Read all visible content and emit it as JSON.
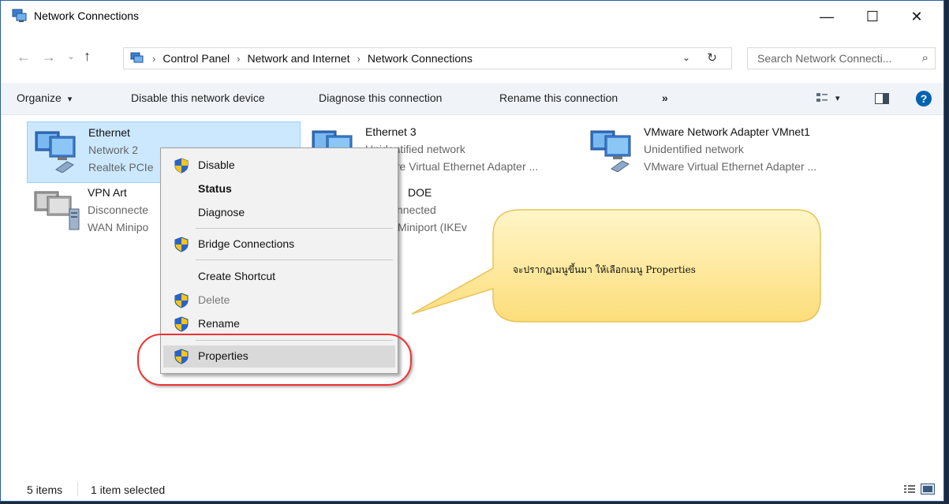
{
  "window": {
    "title": "Network Connections",
    "controls": {
      "minimize": "—",
      "maximize": "☐",
      "close": "✕"
    }
  },
  "navigation": {
    "back": "←",
    "forward": "→",
    "recent": "⌄",
    "up": "↑",
    "breadcrumb": [
      "Control Panel",
      "Network and Internet",
      "Network Connections"
    ],
    "separator": "›",
    "dropdown": "⌄",
    "refresh": "↻",
    "search_placeholder": "Search Network Connecti...",
    "search_icon": "⌕"
  },
  "toolbar": {
    "organize": "Organize",
    "organize_arrow": "▾",
    "disable": "Disable this network device",
    "diagnose": "Diagnose this connection",
    "rename": "Rename this connection",
    "more": "»",
    "view_arrow": "▾",
    "help": "?"
  },
  "items": [
    {
      "name": "Ethernet",
      "status": "Network 2",
      "device": "Realtek PCIe",
      "selected": true,
      "icon": "network-adapter-icon"
    },
    {
      "name": "Ethernet 3",
      "status": "Unidentified network",
      "device": "VMware Virtual Ethernet Adapter ...",
      "icon": "network-adapter-icon"
    },
    {
      "name": "VMware Network Adapter VMnet1",
      "status": "Unidentified network",
      "device": "VMware Virtual Ethernet Adapter ...",
      "icon": "network-adapter-icon"
    },
    {
      "name": "VPN Art",
      "status": "Disconnecte",
      "device": "WAN Minipo",
      "icon": "vpn-connection-icon"
    },
    {
      "name": "DOE",
      "status": "nnected",
      "device": "Miniport (IKEv",
      "icon": "vpn-connection-icon"
    }
  ],
  "context_menu": {
    "items": [
      {
        "label": "Disable",
        "icon": "shield-icon"
      },
      {
        "label": "Status",
        "bold": true
      },
      {
        "label": "Diagnose"
      },
      {
        "label": "Bridge Connections",
        "icon": "shield-icon"
      },
      {
        "label": "Create Shortcut"
      },
      {
        "label": "Delete",
        "icon": "shield-icon",
        "disabled": true
      },
      {
        "label": "Rename",
        "icon": "shield-icon"
      },
      {
        "label": "Properties",
        "icon": "shield-icon",
        "highlighted": true
      }
    ]
  },
  "callout": {
    "text": "จะปรากฏเมนูขึ้นมา ให้เลือกเมนู Properties",
    "fill_color": "#fde58f",
    "highlight_color": "#e33333"
  },
  "statusbar": {
    "item_count": "5 items",
    "selection": "1 item selected"
  },
  "colors": {
    "selection_bg": "#cce8ff",
    "toolbar_bg": "#f0f4f9",
    "menu_bg": "#f2f2f2",
    "help_blue": "#0063b1"
  }
}
